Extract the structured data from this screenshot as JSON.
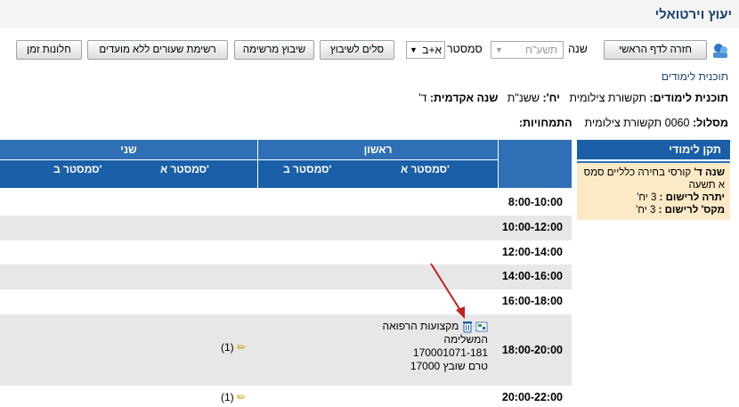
{
  "app": {
    "title": "יעוץ וירטואלי"
  },
  "toolbar": {
    "home_button": "חזרה לדף הראשי",
    "year_label": "שנה",
    "year_value": "תשע\"ח",
    "semester_label": "סמסטר",
    "semester_value": "א+ב",
    "slots_button": "סלים לשיבוץ",
    "schedule_button": "שיבוץ מרשימה",
    "no_date_button": "רשימת שעורים ללא מועדים",
    "time_windows_button": "חלונות זמן"
  },
  "section_link": "תוכנית לימודים",
  "info": {
    "program_label": "תוכנית לימודים:",
    "program_value": "תקשורת צילומית",
    "units_label": "יח':",
    "units_value": "ששנ\"ת",
    "year_label": "שנה אקדמית:",
    "year_value": "ד'",
    "track_label": "מסלול:",
    "track_value": "0060 תקשורת צילומית",
    "specialization_label": "התמחויות:"
  },
  "sidebar": {
    "header": "תקן לימודי",
    "line1_bold": "שנה ד'",
    "line1_text": " קורסי בחירה כלליים סמס א תשעה",
    "line2_label": "יתרה לרישום :",
    "line2_value": " 3 יח'",
    "line3_label": "מקס' לרישום :",
    "line3_value": " 3 יח'"
  },
  "grid": {
    "day1": "ראשון",
    "day2": "שני",
    "sem_a": "סמסטר א'",
    "sem_b": "סמסטר ב'",
    "times": [
      "8:00-10:00",
      "10:00-12:00",
      "12:00-14:00",
      "14:00-16:00",
      "16:00-18:00",
      "18:00-20:00",
      "20:00-22:00"
    ],
    "course": {
      "name": "מקצועות הרפואה המשלימה",
      "code": "170001071-181",
      "status": "טרם שובץ 17000"
    },
    "count_label": "(1)"
  },
  "colors": {
    "accent": "#1a5fa8",
    "title": "#1a3f73",
    "sidebar_bg": "#fce9c6"
  }
}
